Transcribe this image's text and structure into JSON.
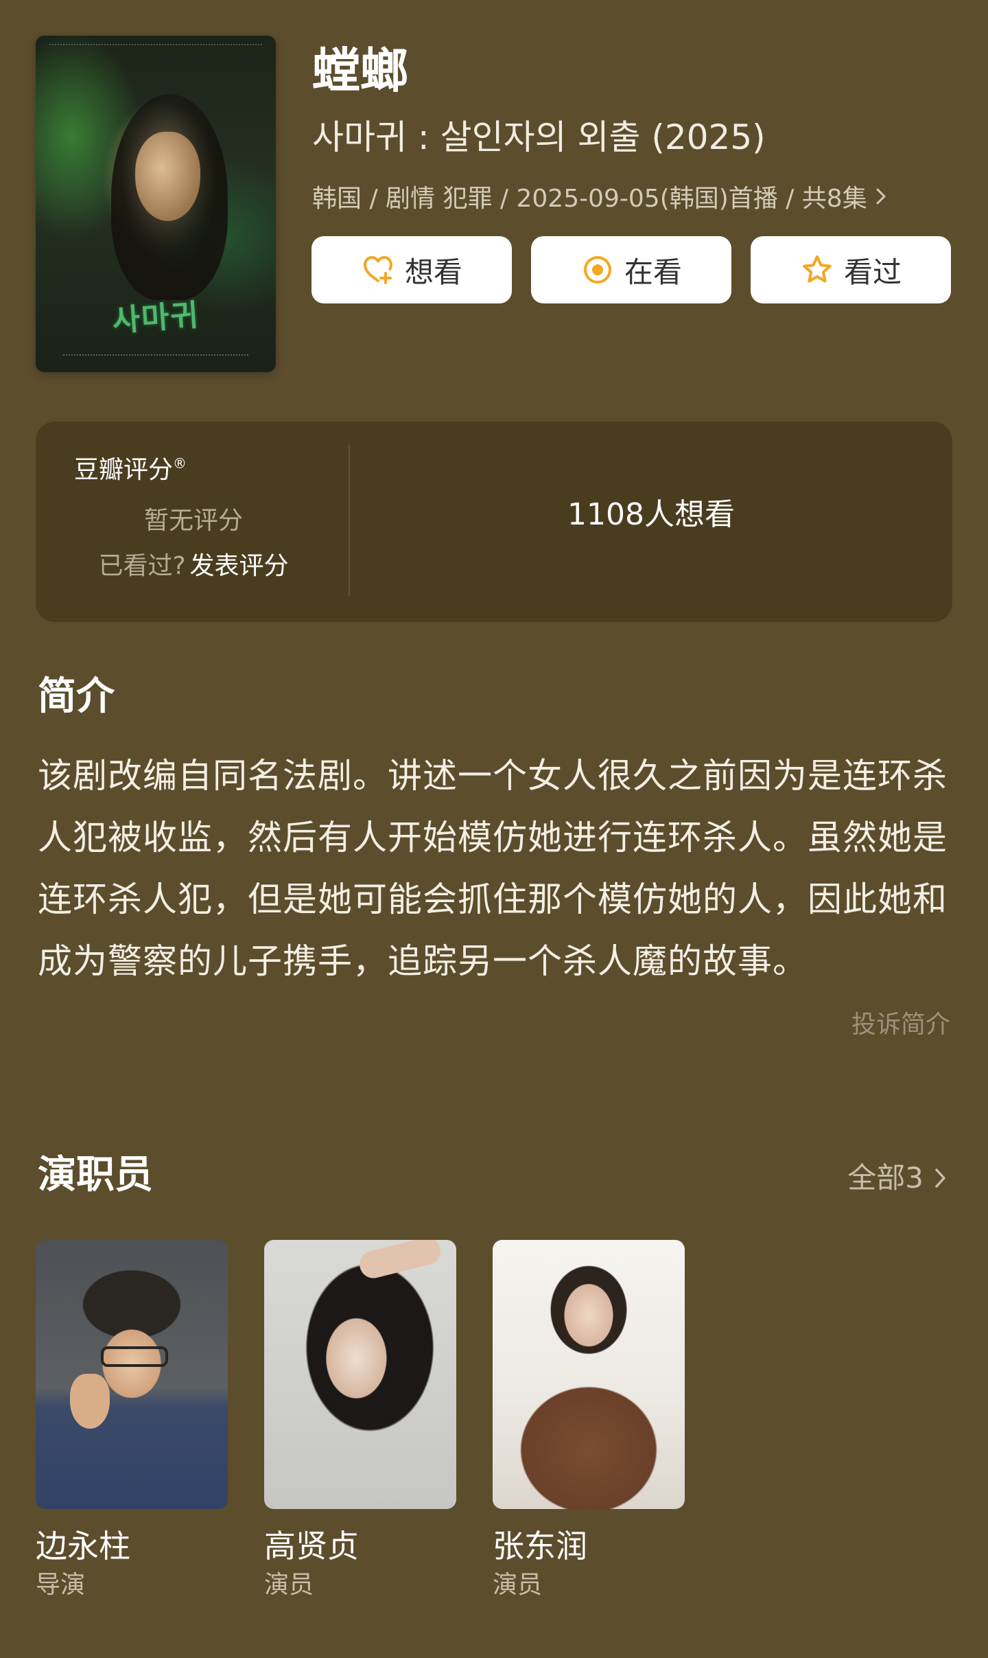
{
  "header": {
    "title_cn": "螳螂",
    "title_original": "사마귀 : 살인자의 외출 (2025)",
    "meta": "韩国 / 剧情 犯罪 / 2025-09-05(韩国)首播 / 共8集",
    "meta_chevron_icon": "chevron-right-icon",
    "poster_logo_text": "사마귀"
  },
  "actions": {
    "want": {
      "label": "想看",
      "icon": "heart-plus-icon",
      "color": "#f5a623"
    },
    "watching": {
      "label": "在看",
      "icon": "target-circle-icon",
      "color": "#f5a623"
    },
    "watched": {
      "label": "看过",
      "icon": "star-icon",
      "color": "#f5a623"
    }
  },
  "rating": {
    "brand": "豆瓣评分",
    "brand_mark": "®",
    "no_score": "暂无评分",
    "seen_prompt": "已看过?",
    "rate_link": "发表评分",
    "want_count": "1108人想看"
  },
  "intro": {
    "title": "简介",
    "text": "该剧改编自同名法剧。讲述一个女人很久之前因为是连环杀人犯被收监，然后有人开始模仿她进行连环杀人。虽然她是连环杀人犯，但是她可能会抓住那个模仿她的人，因此她和成为警察的儿子携手，追踪另一个杀人魔的故事。",
    "report_link": "投诉简介"
  },
  "cast": {
    "title": "演职员",
    "all_label": "全部3",
    "members": [
      {
        "name": "边永柱",
        "role": "导演"
      },
      {
        "name": "高贤贞",
        "role": "演员"
      },
      {
        "name": "张东润",
        "role": "演员"
      }
    ]
  },
  "colors": {
    "background": "#5c4d2d",
    "card": "#4a3c1f",
    "accent": "#f5a623"
  }
}
